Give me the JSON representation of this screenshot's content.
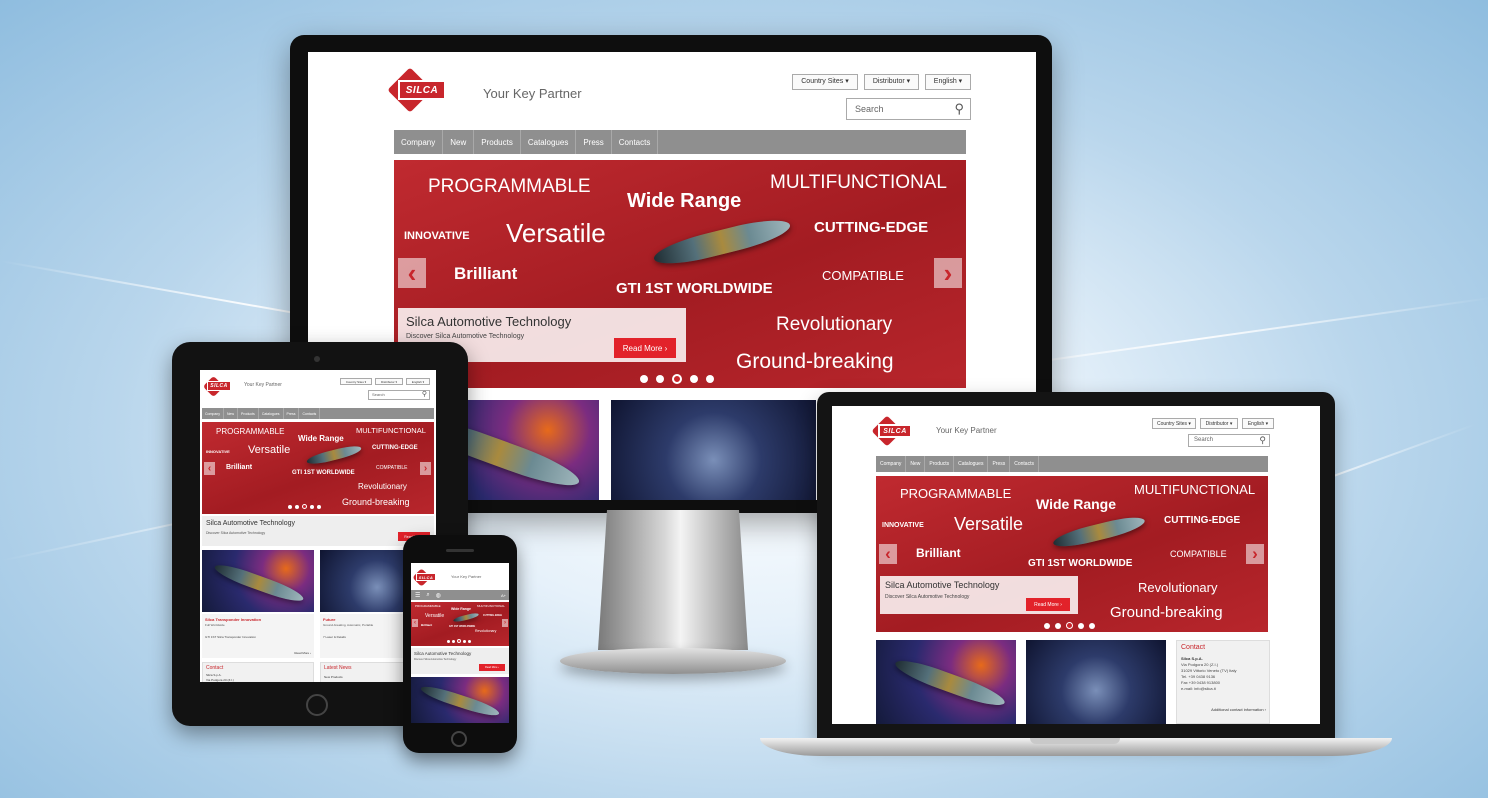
{
  "site": {
    "brand": "SILCA",
    "tagline": "Your Key Partner",
    "dropdowns": [
      "Country Sites ▾",
      "Distributor ▾",
      "English ▾"
    ],
    "search_placeholder": "Search",
    "nav": [
      "Company",
      "New",
      "Products",
      "Catalogues",
      "Press",
      "Contacts"
    ],
    "hero_words": {
      "programmable": "PROGRAMMABLE",
      "wide_range": "Wide Range",
      "multifunctional": "MULTIFUNCTIONAL",
      "innovative": "INNOVATIVE",
      "versatile": "Versatile",
      "cutting_edge": "CUTTING-EDGE",
      "brilliant": "Brilliant",
      "gti": "GTI 1ST WORLDWIDE",
      "compatible": "COMPATIBLE",
      "revolutionary": "Revolutionary",
      "ground_breaking": "Ground-breaking"
    },
    "caption_title": "Silca Automotive Technology",
    "caption_desc": "Discover Silca Automotive Technology",
    "read_more": "Read More ›",
    "arrow_left": "‹",
    "arrow_right": "›",
    "contact": {
      "title": "Contact",
      "company": "Silca S.p.A.",
      "address1": "Via Podgora 20 (Z.I.)",
      "address2": "31029 Vittorio Veneto (TV) Italy",
      "tel": "Tel. +39 0438 9136",
      "fax": "Fax +39 0438 913800",
      "email": "e-mail: info@silca.it",
      "link": "Additional contact information ›"
    },
    "tablet_news": {
      "item1_title": "Silca Transponder Innovation",
      "item1_sub": "Full Worldwide",
      "item1_text": "GTI 1ST Silca Transponder Innovation",
      "item2_title": "Future",
      "item2_sub": "Ground-breaking, Automatic, Portable",
      "item2_text": "7 Laser & Details",
      "read_more_small": "Read More ›",
      "contact_title": "Contact",
      "contact_company": "Silca S.p.A.",
      "contact_addr": "Via Podgora 20 (Z.I.)",
      "latest_title": "Latest News",
      "latest_item": "New Products"
    },
    "phone_menu_icon": "☰",
    "phone_search_icon": "⌕",
    "phone_globe_icon": "◍",
    "phone_extra": "A+"
  }
}
